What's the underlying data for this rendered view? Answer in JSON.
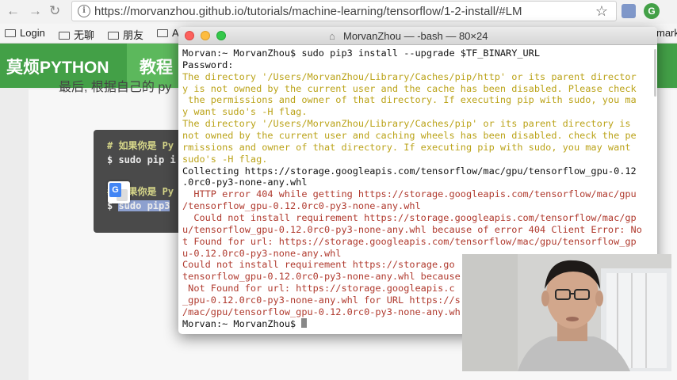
{
  "browser": {
    "url": "https://morvanzhou.github.io/tutorials/machine-learning/tensorflow/1-2-install/#LM",
    "extension_right": "G"
  },
  "bookmarks": [
    {
      "label": "Login"
    },
    {
      "label": "无聊"
    },
    {
      "label": "朋友"
    },
    {
      "label": "Al"
    }
  ],
  "bookmarks_overflow": "mark",
  "site": {
    "logo": "莫烦PYTHON",
    "nav_tab": "教程",
    "paragraph": "最后, 根据自己的 py",
    "code": [
      {
        "text": "# 如果你是 Py"
      },
      {
        "text": "$ sudo pip i"
      },
      {
        "text": "# 如果你是 Py"
      },
      {
        "prompt": "$ ",
        "selected": "sudo pip3"
      }
    ]
  },
  "terminal": {
    "title": "MorvanZhou — -bash — 80×24",
    "lines": [
      {
        "kind": "normal",
        "text": "Morvan:~ MorvanZhou$ sudo pip3 install --upgrade $TF_BINARY_URL"
      },
      {
        "kind": "normal",
        "text": "Password:"
      },
      {
        "kind": "warn",
        "text": "The directory '/Users/MorvanZhou/Library/Caches/pip/http' or its parent director"
      },
      {
        "kind": "warn",
        "text": "y is not owned by the current user and the cache has been disabled. Please check"
      },
      {
        "kind": "warn",
        "text": " the permissions and owner of that directory. If executing pip with sudo, you ma"
      },
      {
        "kind": "warn",
        "text": "y want sudo's -H flag."
      },
      {
        "kind": "warn",
        "text": "The directory '/Users/MorvanZhou/Library/Caches/pip' or its parent directory is"
      },
      {
        "kind": "warn",
        "text": "not owned by the current user and caching wheels has been disabled. check the pe"
      },
      {
        "kind": "warn",
        "text": "rmissions and owner of that directory. If executing pip with sudo, you may want"
      },
      {
        "kind": "warn",
        "text": "sudo's -H flag."
      },
      {
        "kind": "normal",
        "text": "Collecting https://storage.googleapis.com/tensorflow/mac/gpu/tensorflow_gpu-0.12"
      },
      {
        "kind": "normal",
        "text": ".0rc0-py3-none-any.whl"
      },
      {
        "kind": "err",
        "text": "  HTTP error 404 while getting https://storage.googleapis.com/tensorflow/mac/gpu"
      },
      {
        "kind": "err",
        "text": "/tensorflow_gpu-0.12.0rc0-py3-none-any.whl"
      },
      {
        "kind": "err",
        "text": "  Could not install requirement https://storage.googleapis.com/tensorflow/mac/gp"
      },
      {
        "kind": "err",
        "text": "u/tensorflow_gpu-0.12.0rc0-py3-none-any.whl because of error 404 Client Error: No"
      },
      {
        "kind": "err",
        "text": "t Found for url: https://storage.googleapis.com/tensorflow/mac/gpu/tensorflow_gp"
      },
      {
        "kind": "err",
        "text": "u-0.12.0rc0-py3-none-any.whl"
      },
      {
        "kind": "err",
        "text": "Could not install requirement https://storage.go"
      },
      {
        "kind": "err",
        "text": "tensorflow_gpu-0.12.0rc0-py3-none-any.whl because"
      },
      {
        "kind": "err",
        "text": " Not Found for url: https://storage.googleapis.c"
      },
      {
        "kind": "err",
        "text": "_gpu-0.12.0rc0-py3-none-any.whl for URL https://s"
      },
      {
        "kind": "err",
        "text": "/mac/gpu/tensorflow_gpu-0.12.0rc0-py3-none-any.wh"
      }
    ],
    "prompt": "Morvan:~ MorvanZhou$ "
  }
}
